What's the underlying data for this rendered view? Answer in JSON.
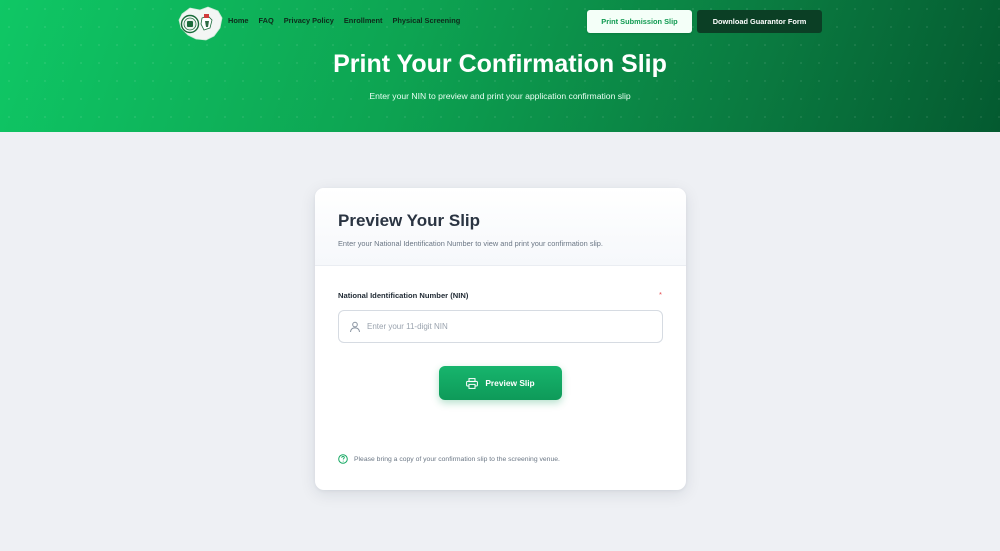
{
  "nav": {
    "items": [
      {
        "label": "Home"
      },
      {
        "label": "FAQ"
      },
      {
        "label": "Privacy Policy"
      },
      {
        "label": "Enrollment"
      },
      {
        "label": "Physical Screening"
      }
    ],
    "print_submission_label": "Print Submission Slip",
    "download_guarantor_label": "Download Guarantor Form"
  },
  "hero": {
    "title": "Print Your Confirmation Slip",
    "subtitle": "Enter your NIN to preview and print your application confirmation slip"
  },
  "card": {
    "title": "Preview Your Slip",
    "description": "Enter your National Identification Number to view and print your confirmation slip.",
    "field_label": "National Identification Number (NIN)",
    "required_marker": "*",
    "input_value": "",
    "input_placeholder": "Enter your 11-digit NIN",
    "button_label": "Preview Slip",
    "note": "Please bring a copy of your confirmation slip to the screening venue."
  },
  "icons": {
    "logo": "nigeria-map-coat-of-arms-icon",
    "input": "user-icon",
    "button": "printer-icon",
    "note": "help-circle-icon"
  },
  "colors": {
    "brand_green": "#0fc765",
    "dark_green": "#045a30",
    "button_green": "#0e9a59",
    "guarantor_button": "#0b3f25",
    "page_background": "#eef0f4",
    "required": "#e5484d"
  }
}
